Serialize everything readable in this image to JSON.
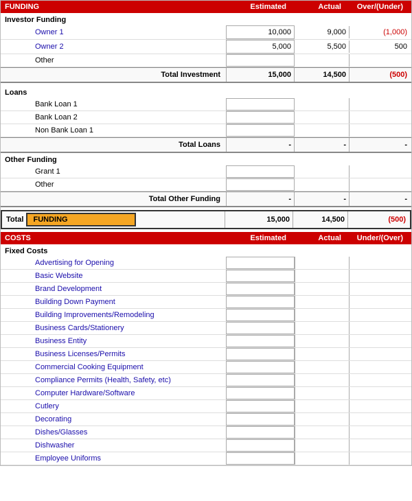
{
  "header": {
    "funding_label": "FUNDING",
    "estimated_label": "Estimated",
    "actual_label": "Actual",
    "over_under_label": "Over/(Under)"
  },
  "investor": {
    "section_label": "Investor Funding",
    "owner1_label": "Owner 1",
    "owner1_est": "10,000",
    "owner1_act": "9,000",
    "owner1_over": "(1,000)",
    "owner2_label": "Owner 2",
    "owner2_est": "5,000",
    "owner2_act": "5,500",
    "owner2_over": "500",
    "other_label": "Other",
    "total_label": "Total Investment",
    "total_est": "15,000",
    "total_act": "14,500",
    "total_over": "(500)"
  },
  "loans": {
    "section_label": "Loans",
    "bank1_label": "Bank Loan 1",
    "bank2_label": "Bank Loan 2",
    "nonbank1_label": "Non Bank Loan 1",
    "total_label": "Total Loans",
    "total_est": "-",
    "total_act": "-",
    "total_over": "-"
  },
  "other_funding": {
    "section_label": "Other Funding",
    "grant1_label": "Grant 1",
    "other_label": "Other",
    "total_label": "Total Other Funding",
    "total_est": "-",
    "total_act": "-",
    "total_over": "-"
  },
  "grand_total": {
    "total_label": "Total",
    "funding_label": "FUNDING",
    "est": "15,000",
    "act": "14,500",
    "over": "(500)"
  },
  "costs_header": {
    "label": "COSTS",
    "estimated": "Estimated",
    "actual": "Actual",
    "under_over": "Under/(Over)"
  },
  "fixed_costs": {
    "section_label": "Fixed Costs",
    "items": [
      "Advertising for Opening",
      "Basic Website",
      "Brand Development",
      "Building Down Payment",
      "Building Improvements/Remodeling",
      "Business Cards/Stationery",
      "Business Entity",
      "Business Licenses/Permits",
      "Commercial Cooking Equipment",
      "Compliance Permits (Health, Safety, etc)",
      "Computer Hardware/Software",
      "Cutlery",
      "Decorating",
      "Dishes/Glasses",
      "Dishwasher",
      "Employee Uniforms"
    ]
  }
}
